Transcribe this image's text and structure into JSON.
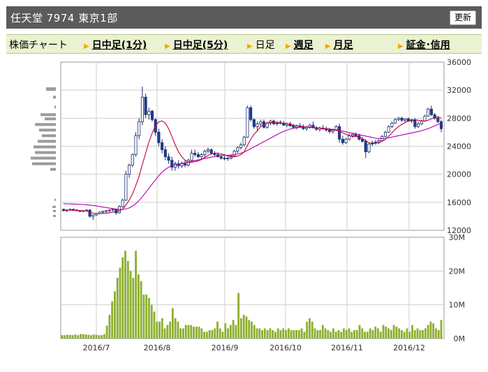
{
  "header": {
    "title": "任天堂 7974 東京1部",
    "refresh_label": "更新"
  },
  "tabs": [
    {
      "label": "株価チャート",
      "link": false,
      "arrow": false
    },
    {
      "label": "日中足(1分)",
      "link": true,
      "arrow": true
    },
    {
      "label": "日中足(5分)",
      "link": true,
      "arrow": true
    },
    {
      "label": "日足",
      "link": false,
      "arrow": true
    },
    {
      "label": "週足",
      "link": true,
      "arrow": true
    },
    {
      "label": "月足",
      "link": true,
      "arrow": true
    },
    {
      "label": "証金･信用",
      "link": true,
      "arrow": true
    }
  ],
  "chart_data": [
    {
      "type": "candlestick",
      "y_tick_labels": [
        "36000",
        "32000",
        "28000",
        "24000",
        "20000",
        "16000",
        "12000"
      ],
      "ylim": [
        12000,
        36000
      ],
      "x_tick_labels": [
        "2016/7",
        "2016/8",
        "2016/9",
        "2016/10",
        "2016/11",
        "2016/12"
      ],
      "colors": {
        "up": "#ffffff",
        "down": "#1c3f94",
        "ma_short": "#c0003c",
        "ma_long": "#b000b0",
        "grid": "#cfcfcf",
        "profile": "#9a9a9a"
      },
      "candles": [
        [
          15000,
          15100,
          14700,
          14800
        ],
        [
          14800,
          15000,
          14600,
          14900
        ],
        [
          14900,
          15100,
          14800,
          15000
        ],
        [
          15000,
          15100,
          14800,
          14900
        ],
        [
          14900,
          15000,
          14700,
          14800
        ],
        [
          14800,
          14900,
          14600,
          14700
        ],
        [
          14700,
          14900,
          14600,
          14800
        ],
        [
          14800,
          15000,
          14700,
          14900
        ],
        [
          14900,
          15000,
          13800,
          14000
        ],
        [
          14000,
          14300,
          13500,
          14200
        ],
        [
          14200,
          14500,
          14000,
          14400
        ],
        [
          14400,
          14700,
          14300,
          14600
        ],
        [
          14600,
          14800,
          14400,
          14700
        ],
        [
          14700,
          14900,
          14500,
          14800
        ],
        [
          14800,
          15000,
          14600,
          14900
        ],
        [
          14900,
          15100,
          14700,
          15000
        ],
        [
          15000,
          15100,
          14200,
          14500
        ],
        [
          14500,
          15600,
          14400,
          15400
        ],
        [
          15400,
          16500,
          15200,
          16300
        ],
        [
          16300,
          20500,
          16200,
          20000
        ],
        [
          20000,
          21500,
          19500,
          21300
        ],
        [
          21300,
          23000,
          21000,
          22800
        ],
        [
          22800,
          26000,
          22500,
          25500
        ],
        [
          25500,
          28000,
          25000,
          27500
        ],
        [
          27500,
          32500,
          27000,
          31000
        ],
        [
          31000,
          31500,
          28000,
          28500
        ],
        [
          28500,
          29500,
          27800,
          29000
        ],
        [
          29000,
          29200,
          27500,
          27800
        ],
        [
          27800,
          28000,
          25500,
          26000
        ],
        [
          26000,
          26500,
          24000,
          24500
        ],
        [
          24500,
          25000,
          23000,
          23500
        ],
        [
          23500,
          24000,
          22000,
          22500
        ],
        [
          22500,
          23000,
          21500,
          22000
        ],
        [
          22000,
          22500,
          20500,
          21000
        ],
        [
          21000,
          21800,
          20500,
          21500
        ],
        [
          21500,
          22000,
          20800,
          21200
        ],
        [
          21200,
          21800,
          20900,
          21500
        ],
        [
          21500,
          22000,
          21000,
          21300
        ],
        [
          21300,
          22200,
          21100,
          22000
        ],
        [
          22000,
          23500,
          21800,
          23000
        ],
        [
          23000,
          23500,
          22500,
          22800
        ],
        [
          22800,
          23200,
          22300,
          22500
        ],
        [
          22500,
          23000,
          22200,
          22800
        ],
        [
          22800,
          23500,
          22500,
          23300
        ],
        [
          23300,
          23800,
          23000,
          23500
        ],
        [
          23500,
          23700,
          22800,
          23000
        ],
        [
          23000,
          23300,
          22600,
          22800
        ],
        [
          22800,
          23100,
          22400,
          22500
        ],
        [
          22500,
          22800,
          22100,
          22300
        ],
        [
          22300,
          22600,
          22000,
          22200
        ],
        [
          22200,
          22500,
          21900,
          22300
        ],
        [
          22300,
          22800,
          22100,
          22600
        ],
        [
          22600,
          23500,
          22500,
          23300
        ],
        [
          23300,
          24000,
          23000,
          23800
        ],
        [
          23800,
          24500,
          23500,
          24200
        ],
        [
          24200,
          25500,
          24000,
          25300
        ],
        [
          25300,
          29800,
          25200,
          29500
        ],
        [
          29500,
          29800,
          27500,
          27800
        ],
        [
          27800,
          28000,
          26500,
          26800
        ],
        [
          26800,
          27500,
          26200,
          27200
        ],
        [
          27200,
          27800,
          26800,
          27500
        ],
        [
          27500,
          27800,
          26500,
          26700
        ],
        [
          26700,
          27500,
          26500,
          27300
        ],
        [
          27300,
          27800,
          27000,
          27600
        ],
        [
          27600,
          27800,
          27000,
          27200
        ],
        [
          27200,
          27600,
          26900,
          27400
        ],
        [
          27400,
          27700,
          27100,
          27300
        ],
        [
          27300,
          27600,
          26900,
          27000
        ],
        [
          27000,
          27400,
          26700,
          27200
        ],
        [
          27200,
          27500,
          26800,
          26900
        ],
        [
          26900,
          27200,
          26500,
          26700
        ],
        [
          26700,
          27100,
          26400,
          26900
        ],
        [
          26900,
          27300,
          26600,
          26800
        ],
        [
          26800,
          27100,
          26300,
          26500
        ],
        [
          26500,
          26900,
          26200,
          26700
        ],
        [
          26700,
          27200,
          26500,
          27000
        ],
        [
          27000,
          27500,
          26800,
          26600
        ],
        [
          26600,
          26900,
          26200,
          26400
        ],
        [
          26400,
          26800,
          26100,
          26600
        ],
        [
          26600,
          27000,
          26300,
          26500
        ],
        [
          26500,
          26800,
          26100,
          26300
        ],
        [
          26300,
          26600,
          25800,
          26100
        ],
        [
          26100,
          26500,
          25800,
          26300
        ],
        [
          26300,
          27000,
          26200,
          26800
        ],
        [
          26800,
          27200,
          24500,
          25000
        ],
        [
          25000,
          25500,
          24200,
          24500
        ],
        [
          24500,
          25200,
          24300,
          25000
        ],
        [
          25000,
          25800,
          24800,
          25500
        ],
        [
          25500,
          25900,
          25200,
          25700
        ],
        [
          25700,
          26000,
          25300,
          25500
        ],
        [
          25500,
          25800,
          24800,
          25000
        ],
        [
          25000,
          25300,
          24500,
          24700
        ],
        [
          24700,
          25000,
          22300,
          23200
        ],
        [
          23200,
          24500,
          23000,
          24300
        ],
        [
          24300,
          24800,
          24000,
          24500
        ],
        [
          24500,
          24900,
          24200,
          24600
        ],
        [
          24600,
          25000,
          24300,
          24800
        ],
        [
          24800,
          25600,
          24700,
          25400
        ],
        [
          25400,
          26200,
          25300,
          26000
        ],
        [
          26000,
          27000,
          25900,
          26800
        ],
        [
          26800,
          27500,
          26600,
          27300
        ],
        [
          27300,
          28000,
          27200,
          27800
        ],
        [
          27800,
          28200,
          27600,
          28000
        ],
        [
          28000,
          28200,
          27500,
          27700
        ],
        [
          27700,
          28000,
          27400,
          27900
        ],
        [
          27900,
          28100,
          27500,
          27600
        ],
        [
          27600,
          27900,
          27300,
          27800
        ],
        [
          27800,
          28000,
          26500,
          26800
        ],
        [
          26800,
          27500,
          26600,
          27200
        ],
        [
          27200,
          27800,
          27000,
          27600
        ],
        [
          27600,
          28500,
          27500,
          28300
        ],
        [
          28300,
          29500,
          28200,
          29300
        ],
        [
          29300,
          29800,
          28300,
          28500
        ],
        [
          28500,
          28700,
          27800,
          28000
        ],
        [
          28000,
          28300,
          27300,
          27500
        ],
        [
          27500,
          27800,
          26000,
          26500
        ]
      ],
      "ma_short": [
        14900,
        14880,
        14870,
        14860,
        14850,
        14820,
        14790,
        14770,
        14600,
        14450,
        14380,
        14380,
        14410,
        14450,
        14520,
        14600,
        14640,
        14780,
        15020,
        15600,
        16300,
        17200,
        18400,
        19700,
        21400,
        23000,
        24600,
        25900,
        26900,
        27500,
        27600,
        27300,
        26500,
        25400,
        24200,
        23200,
        22500,
        22000,
        21700,
        21700,
        21800,
        21900,
        22100,
        22400,
        22700,
        22900,
        23000,
        23000,
        22900,
        22800,
        22600,
        22500,
        22500,
        22600,
        22800,
        23200,
        24100,
        25000,
        25700,
        26200,
        26800,
        27100,
        27300,
        27400,
        27400,
        27300,
        27300,
        27300,
        27200,
        27100,
        27000,
        26900,
        26900,
        26800,
        26700,
        26700,
        26700,
        26600,
        26600,
        26500,
        26500,
        26400,
        26300,
        26300,
        26100,
        25900,
        25700,
        25500,
        25400,
        25400,
        25300,
        25100,
        24800,
        24500,
        24400,
        24400,
        24500,
        24700,
        25000,
        25400,
        25900,
        26400,
        26800,
        27100,
        27400,
        27600,
        27700,
        27800,
        27700,
        27600,
        27600,
        27700,
        27900,
        28100,
        28200,
        28000
      ],
      "ma_long": [
        15800,
        15780,
        15760,
        15740,
        15720,
        15700,
        15680,
        15650,
        15600,
        15550,
        15480,
        15400,
        15320,
        15250,
        15170,
        15100,
        15030,
        14980,
        14980,
        15050,
        15200,
        15450,
        15800,
        16250,
        16800,
        17400,
        18000,
        18600,
        19200,
        19800,
        20300,
        20700,
        21000,
        21200,
        21350,
        21450,
        21550,
        21650,
        21750,
        21850,
        21950,
        22050,
        22150,
        22250,
        22350,
        22450,
        22550,
        22650,
        22700,
        22700,
        22700,
        22750,
        22800,
        22900,
        23000,
        23150,
        23400,
        23650,
        23900,
        24150,
        24400,
        24650,
        24900,
        25150,
        25400,
        25650,
        25900,
        26100,
        26300,
        26450,
        26550,
        26650,
        26700,
        26750,
        26750,
        26750,
        26700,
        26650,
        26600,
        26550,
        26500,
        26450,
        26400,
        26350,
        26250,
        26150,
        26050,
        25950,
        25850,
        25750,
        25650,
        25550,
        25450,
        25350,
        25250,
        25150,
        25100,
        25100,
        25150,
        25200,
        25300,
        25400,
        25500,
        25600,
        25700,
        25800,
        25900,
        26000,
        26100,
        26200,
        26350,
        26500,
        26700,
        26900,
        27100,
        27300
      ]
    },
    {
      "type": "bar",
      "y_tick_labels": [
        "30M",
        "20M",
        "10M",
        "0M"
      ],
      "ylim": [
        0,
        30000000
      ],
      "x_tick_labels": [
        "2016/7",
        "2016/8",
        "2016/9",
        "2016/10",
        "2016/11",
        "2016/12"
      ],
      "color": "#8caf2e",
      "values": [
        1000000,
        1000000,
        1100000,
        1100000,
        1000000,
        1200000,
        1000000,
        1300000,
        1300000,
        1200000,
        1100000,
        1000000,
        1200000,
        1100000,
        1000000,
        1000000,
        1300000,
        3800000,
        7000000,
        11000000,
        14000000,
        18000000,
        21000000,
        24000000,
        26000000,
        23000000,
        20000000,
        18000000,
        26000000,
        19000000,
        17000000,
        13000000,
        13000000,
        12000000,
        10000000,
        8000000,
        5000000,
        5000000,
        6000000,
        3000000,
        4000000,
        5000000,
        9000000,
        6000000,
        5000000,
        3000000,
        3000000,
        4000000,
        4000000,
        4000000,
        3500000,
        3500000,
        3500000,
        3000000,
        2000000,
        2000000,
        2500000,
        2500000,
        3000000,
        5000000,
        3000000,
        2000000,
        4500000,
        3000000,
        4000000,
        5500000,
        4000000,
        13500000,
        6000000,
        7000000,
        6500000,
        5500000,
        5000000,
        4000000,
        3000000,
        3000000,
        2500000,
        3000000,
        2500000,
        3000000,
        2500000,
        2000000,
        3000000,
        2500000,
        3000000,
        2500000,
        3000000,
        2500000,
        2500000,
        2500000,
        2500000,
        3000000,
        2000000,
        5000000,
        6000000,
        5000000,
        3000000,
        2500000,
        2500000,
        4000000,
        3000000,
        2500000,
        2000000,
        3000000,
        2000000,
        2500000,
        2000000,
        3000000,
        2500000,
        3000000,
        2000000,
        2500000,
        2500000,
        4000000,
        3000000,
        2000000,
        2000000,
        3000000,
        2500000,
        3500000,
        3000000,
        2000000,
        4000000,
        3500000,
        3000000,
        2500000,
        4000000,
        3500000,
        3000000,
        2500000,
        2000000,
        3000000,
        2000000,
        4000000,
        2500000,
        3000000,
        2500000,
        2500000,
        3000000,
        4000000,
        5000000,
        4500000,
        3000000,
        2500000,
        5500000
      ]
    }
  ]
}
